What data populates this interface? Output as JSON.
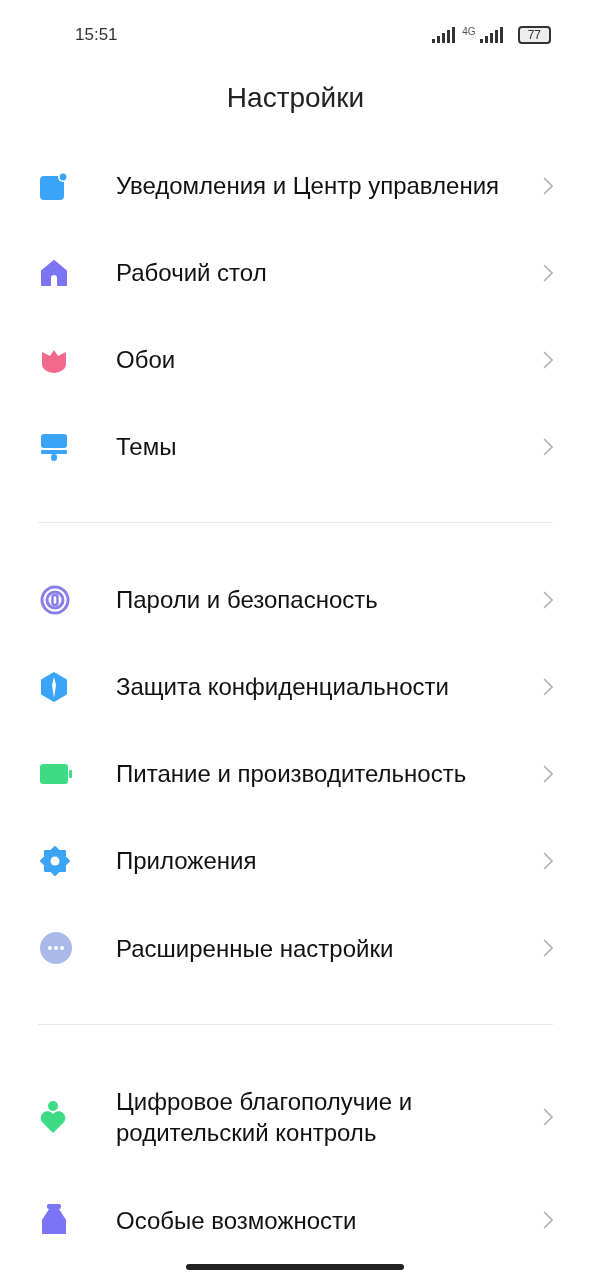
{
  "status_bar": {
    "time": "15:51",
    "network": "4G",
    "battery": "77"
  },
  "title": "Настройки",
  "sections": [
    {
      "items": [
        {
          "label": "Уведомления и Центр управления"
        },
        {
          "label": "Рабочий стол"
        },
        {
          "label": "Обои"
        },
        {
          "label": "Темы"
        }
      ]
    },
    {
      "items": [
        {
          "label": "Пароли и безопасность"
        },
        {
          "label": "Защита конфиденциальности"
        },
        {
          "label": "Питание и производительность"
        },
        {
          "label": "Приложения"
        },
        {
          "label": "Расширенные настройки"
        }
      ]
    },
    {
      "items": [
        {
          "label": "Цифровое благополучие и родительский контроль"
        },
        {
          "label": "Особые возможности"
        }
      ]
    }
  ]
}
